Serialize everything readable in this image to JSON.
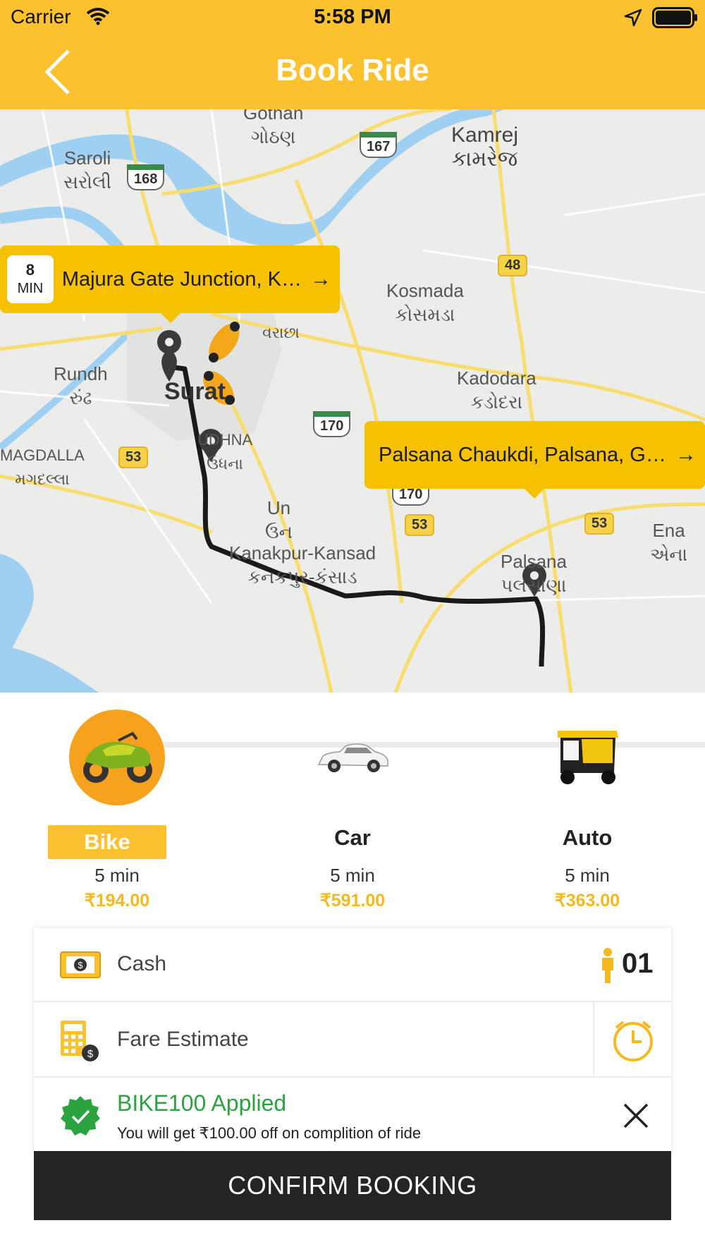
{
  "status_bar": {
    "carrier": "Carrier",
    "time": "5:58 PM"
  },
  "header": {
    "title": "Book Ride"
  },
  "map": {
    "places": [
      {
        "en": "Gothan",
        "gu": "ગોઠણ"
      },
      {
        "en": "Saroli",
        "gu": "સરોલી"
      },
      {
        "en": "Kamrej",
        "gu": "કામરેજ"
      },
      {
        "en": "Kosmada",
        "gu": "કોસમડા"
      },
      {
        "en": "Kadodara",
        "gu": "કડોદરા"
      },
      {
        "en": "Rundh",
        "gu": "રુંઢ"
      },
      {
        "en": "MAGDALLA",
        "gu": "મગદલ્લા"
      },
      {
        "en": "UDHNA",
        "gu": "ઉધના"
      },
      {
        "en": "Un",
        "gu": "ઉન"
      },
      {
        "en": "Kanakpur-Kansad",
        "gu": "કનકપુર-કંસાડ"
      },
      {
        "en": "Palsana",
        "gu": "પલસાણા"
      },
      {
        "en": "Ena",
        "gu": "એના"
      },
      {
        "en": "",
        "gu": "વરાછા"
      }
    ],
    "city": "Surat",
    "highways": [
      "167",
      "168",
      "48",
      "170",
      "170",
      "53",
      "53",
      "53"
    ],
    "pickup": {
      "eta_value": "8",
      "eta_unit": "MIN",
      "address": "Majura Gate Junction, Ka..."
    },
    "dropoff": {
      "address": "Palsana Chaukdi, Palsana, Guj..."
    },
    "route_color": "#1a1a1a"
  },
  "vehicles": [
    {
      "name": "Bike",
      "time": "5 min",
      "price": "₹194.00",
      "selected": true
    },
    {
      "name": "Car",
      "time": "5 min",
      "price": "₹591.00",
      "selected": false
    },
    {
      "name": "Auto",
      "time": "5 min",
      "price": "₹363.00",
      "selected": false
    }
  ],
  "payment": {
    "method": "Cash",
    "passengers": "01"
  },
  "fare": {
    "label": "Fare Estimate"
  },
  "promo": {
    "title": "BIKE100 Applied",
    "subtitle": "You will get ₹100.00 off on complition of ride"
  },
  "confirm": {
    "label": "CONFIRM BOOKING"
  },
  "colors": {
    "brand_yellow": "#fcc12e",
    "accent_orange": "#f7a21e",
    "success_green": "#2ba33e",
    "dark_button": "#242424"
  }
}
